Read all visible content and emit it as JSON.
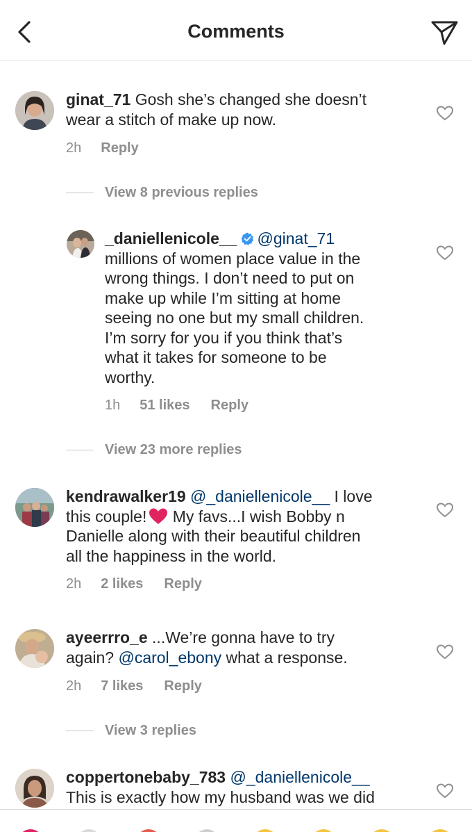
{
  "header": {
    "title": "Comments"
  },
  "comments": [
    {
      "username": "ginat_71",
      "text_line1": " Gosh she’s changed she doesn’t",
      "text_line2": "wear a stitch of make up now.",
      "time": "2h",
      "reply": "Reply"
    },
    {
      "username": "_daniellenicole__",
      "mention": "@ginat_71",
      "lines": [
        "millions of women place value in the",
        "wrong things. I don’t need to put on",
        "make up while I’m sitting at home",
        "seeing no one but my small children.",
        "I’m sorry for you if you think that’s",
        "what it takes for someone to be",
        "worthy."
      ],
      "time": "1h",
      "likes": "51 likes",
      "reply": "Reply"
    },
    {
      "username": "kendrawalker19",
      "mention": "@_daniellenicole__",
      "text_after_mention": " I love",
      "line2": "this couple!",
      "line2_after": " My favs...I wish Bobby n",
      "line3": "Danielle along with their beautiful children",
      "line4": "all the happiness in the world.",
      "time": "2h",
      "likes": "2 likes",
      "reply": "Reply"
    },
    {
      "username": "ayeerrro_e",
      "text_line1": " ...We’re gonna have to try",
      "line2_before": "again? ",
      "mention": "@carol_ebony",
      "line2_after": " what a response.",
      "time": "2h",
      "likes": "7 likes",
      "reply": "Reply"
    },
    {
      "username": "coppertonebaby_783",
      "mention": "@_daniellenicole__",
      "line2": "This is exactly how my husband was we did"
    }
  ],
  "view_replies": {
    "first": "View 8 previous replies",
    "second": "View 23 more replies",
    "third": "View 3 replies"
  },
  "colors": {
    "text": "#262626",
    "secondary": "#8e8e8e",
    "mention": "#00376b",
    "verified": "#3897f0",
    "heart_emoji": "#e0245e"
  },
  "icons": [
    "back-icon",
    "send-icon",
    "like-icon",
    "verified-icon",
    "red-heart-emoji"
  ]
}
